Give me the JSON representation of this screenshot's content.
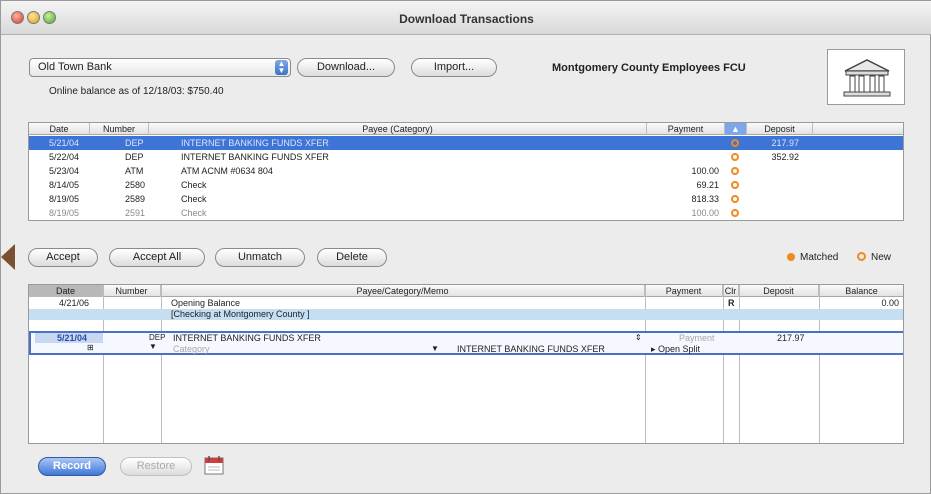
{
  "window": {
    "title": "Download Transactions"
  },
  "account": {
    "selected": "Old Town Bank",
    "online_balance": "Online balance as of 12/18/03: $750.40",
    "fi_name": "Montgomery County Employees FCU"
  },
  "toolbar": {
    "download_label": "Download...",
    "import_label": "Import..."
  },
  "downloaded": {
    "headers": [
      "Date",
      "Number",
      "Payee (Category)",
      "Payment",
      "",
      "Deposit"
    ],
    "rows": [
      {
        "date": "5/21/04",
        "number": "DEP",
        "payee": "INTERNET BANKING FUNDS XFER",
        "payment": "",
        "deposit": "217.97",
        "selected": true
      },
      {
        "date": "5/22/04",
        "number": "DEP",
        "payee": "INTERNET BANKING FUNDS XFER",
        "payment": "",
        "deposit": "352.92"
      },
      {
        "date": "5/23/04",
        "number": "ATM",
        "payee": "ATM ACNM #0634 804",
        "payment": "100.00",
        "deposit": ""
      },
      {
        "date": "8/14/05",
        "number": "2580",
        "payee": "Check",
        "payment": "69.21",
        "deposit": ""
      },
      {
        "date": "8/19/05",
        "number": "2589",
        "payee": "Check",
        "payment": "818.33",
        "deposit": ""
      },
      {
        "date": "8/19/05",
        "number": "2591",
        "payee": "Check",
        "payment": "100.00",
        "deposit": ""
      }
    ]
  },
  "actions": {
    "accept": "Accept",
    "accept_all": "Accept All",
    "unmatch": "Unmatch",
    "delete": "Delete"
  },
  "legend": {
    "matched": "Matched",
    "new": "New",
    "matched_color": "#ef8a1d",
    "new_color": "#ef8a1d"
  },
  "register": {
    "headers": [
      "Date",
      "Number",
      "Payee/Category/Memo",
      "Payment",
      "Clr",
      "Deposit",
      "Balance"
    ],
    "opening": {
      "date": "4/21/06",
      "payee": "Opening Balance",
      "clr": "R",
      "balance": "0.00"
    },
    "transfer_row": "[Checking at Montgomery County ]",
    "edit": {
      "date": "5/21/04",
      "number": "DEP",
      "payee": "INTERNET BANKING FUNDS XFER",
      "category_placeholder": "Category",
      "memo": "INTERNET BANKING FUNDS XFER",
      "payment_placeholder": "Payment",
      "deposit": "217.97",
      "split": "Open Split"
    }
  },
  "bottom": {
    "record": "Record",
    "restore": "Restore"
  },
  "colors": {
    "selection": "#3d74d6",
    "accent_ring": "#ef8a1d",
    "edit_border": "#4a70c8"
  }
}
